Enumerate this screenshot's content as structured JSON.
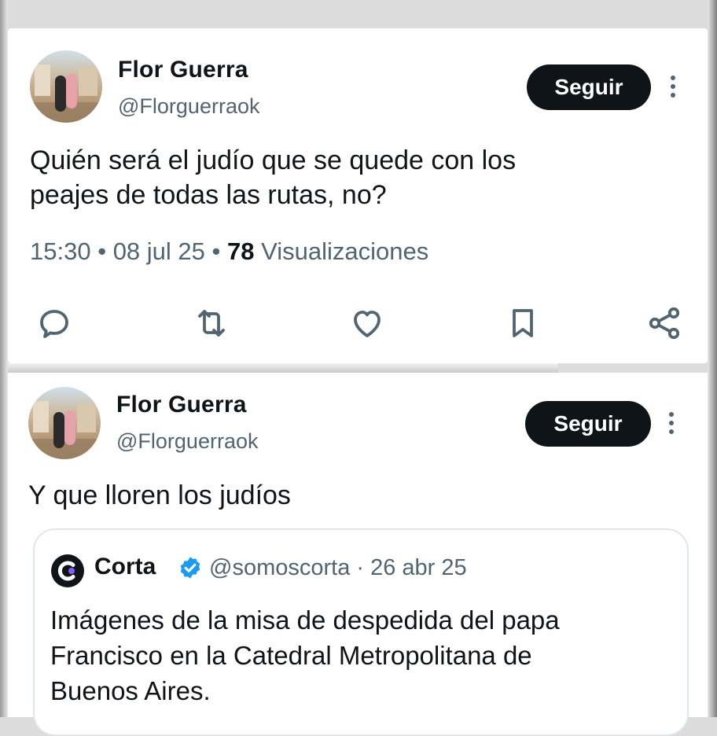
{
  "posts": [
    {
      "author": {
        "name": "Flor Guerra",
        "handle": "@Florguerraok"
      },
      "follow_label": "Seguir",
      "text_lines": [
        "Quién será el judío que se quede con los",
        "peajes de todas las rutas, no?"
      ],
      "time": "15:30",
      "date": "08 jul 25",
      "views_count": "78",
      "views_label": "Visualizaciones",
      "actions": [
        "reply-icon",
        "repost-icon",
        "like-icon",
        "bookmark-icon",
        "share-icon"
      ]
    },
    {
      "author": {
        "name": "Flor Guerra",
        "handle": "@Florguerraok"
      },
      "follow_label": "Seguir",
      "text": "Y que lloren los judíos",
      "quote": {
        "name": "Corta",
        "handle_date": "@somoscorta · 26 abr 25",
        "text_lines": [
          "Imágenes de la misa de despedida del papa",
          "Francisco en la Catedral Metropolitana de",
          "Buenos Aires."
        ]
      }
    }
  ],
  "colors": {
    "text": "#0f1419",
    "secondary": "#536471",
    "button": "#0f1419",
    "verified": "#1d9bf0"
  }
}
